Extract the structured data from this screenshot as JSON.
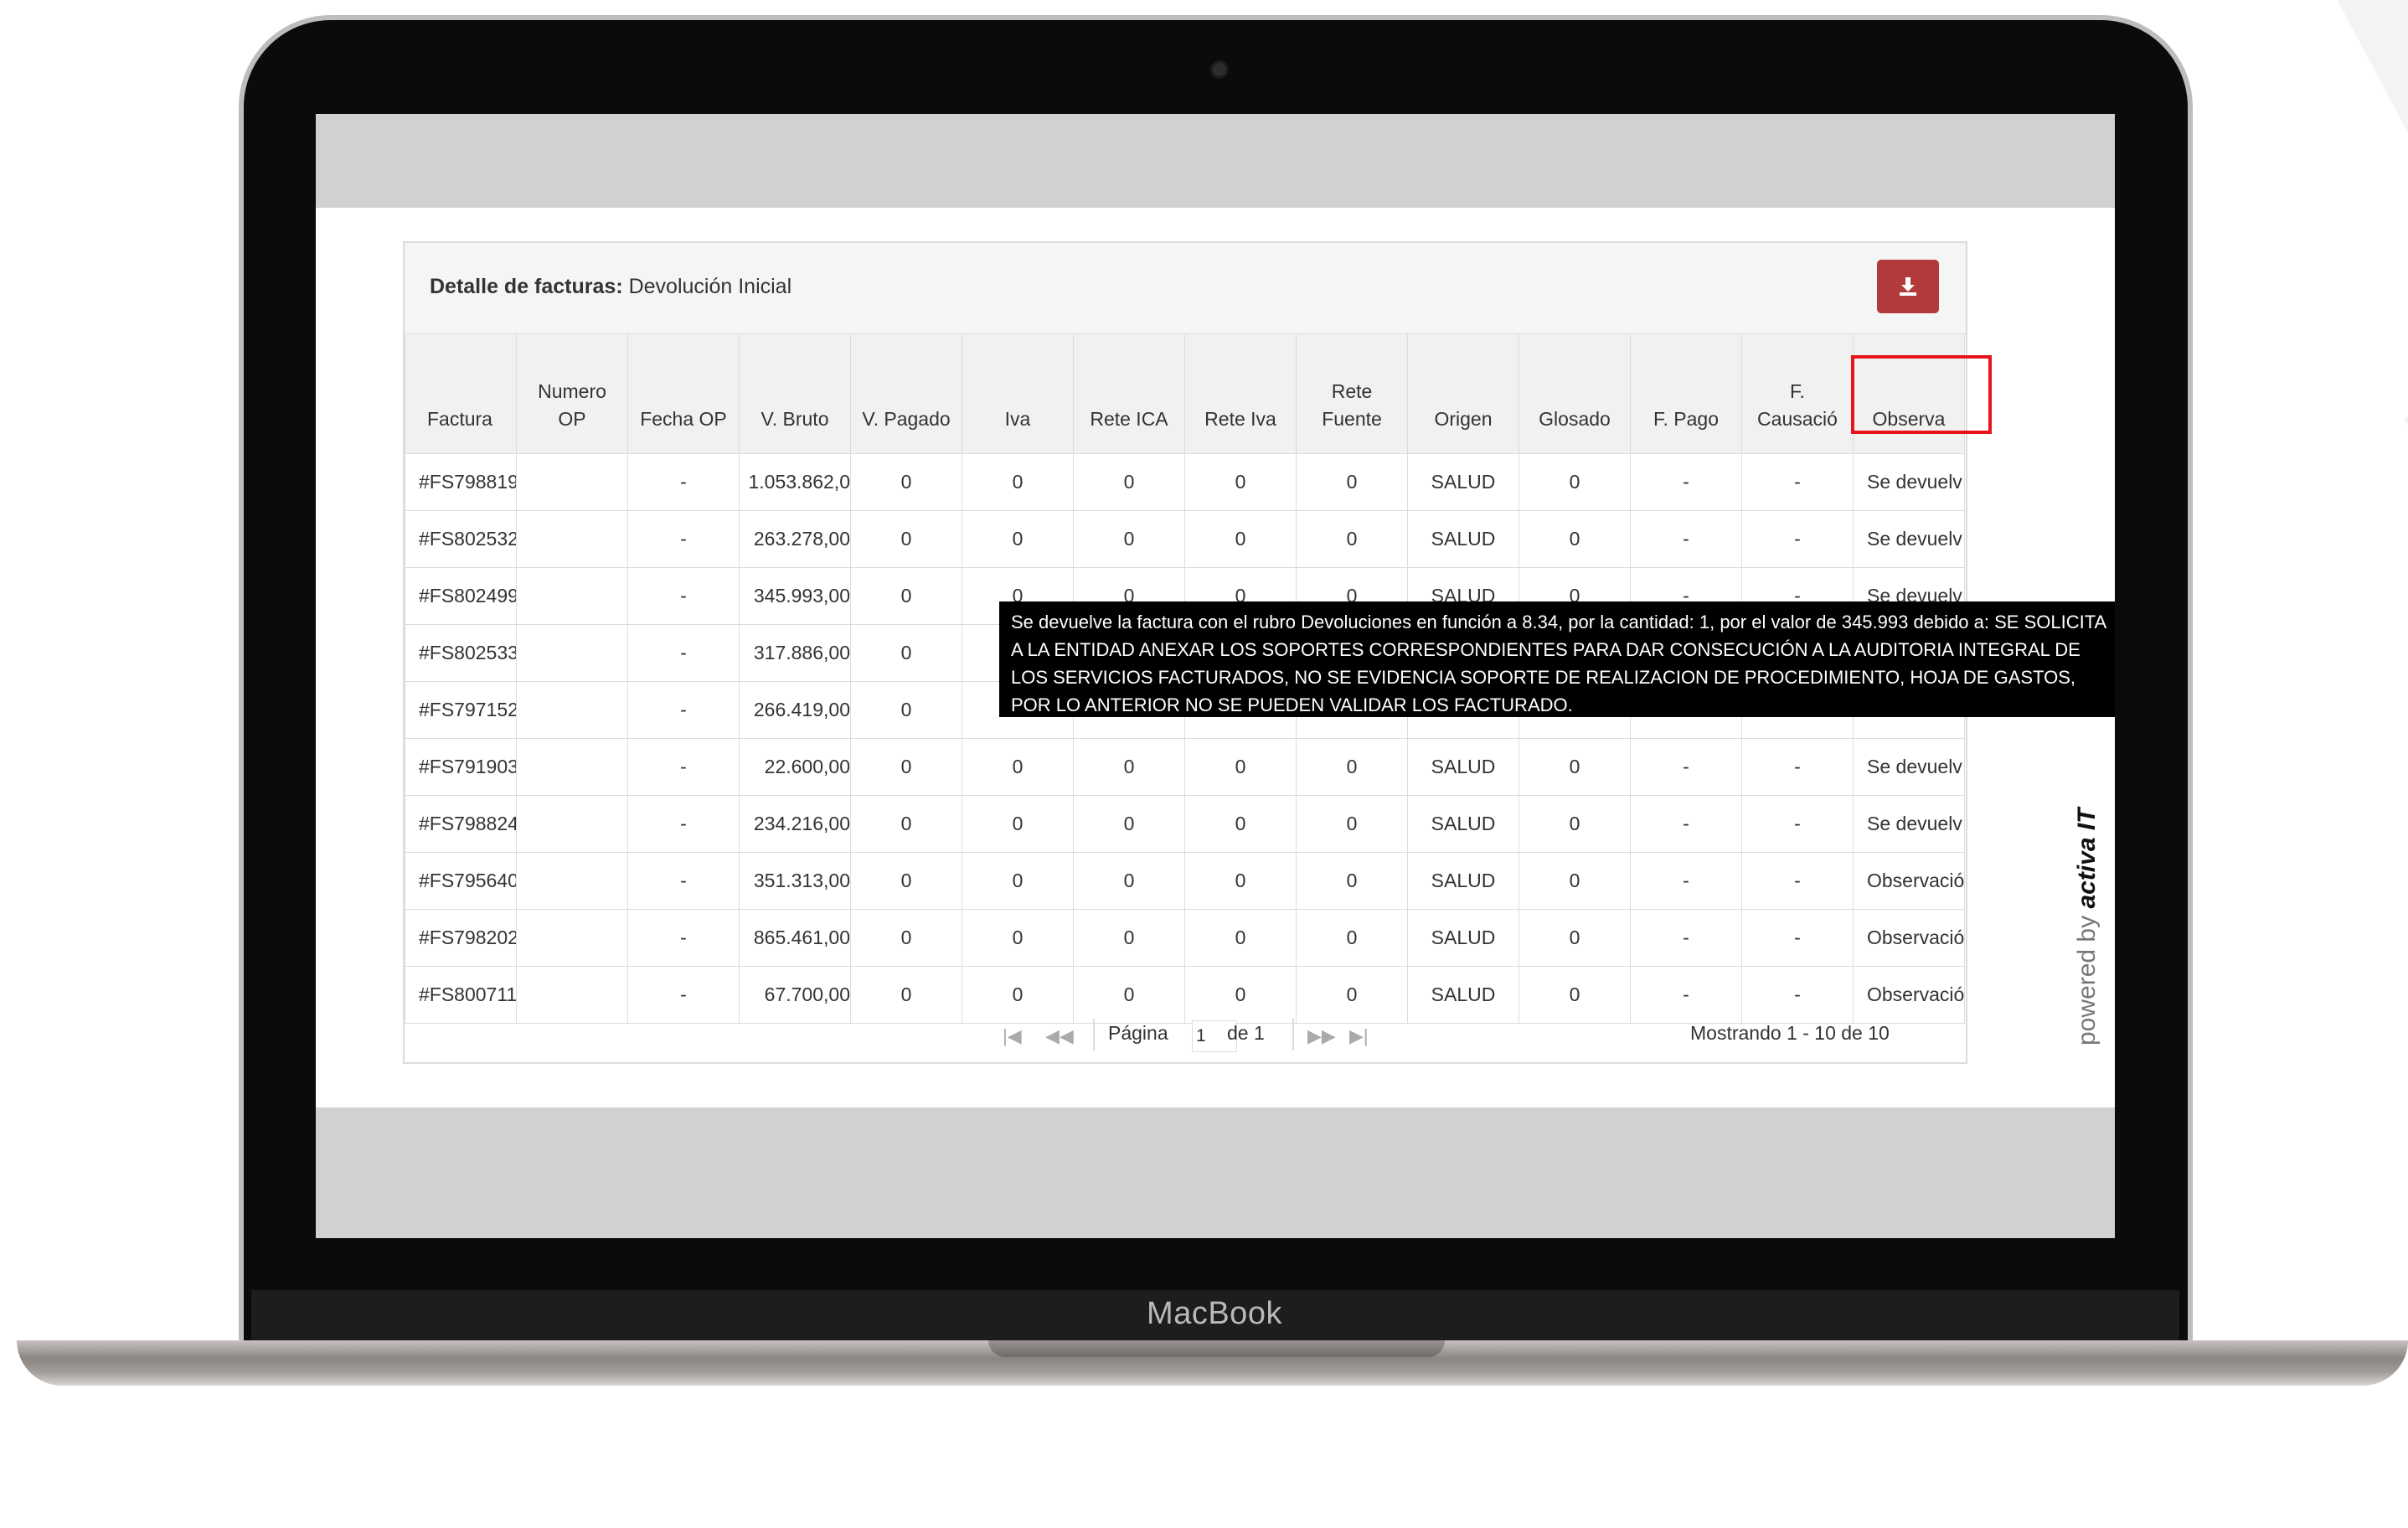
{
  "device": {
    "brand_label": "MacBook"
  },
  "panel": {
    "title_label": "Detalle de facturas:",
    "title_value": "Devolución Inicial",
    "download_icon": "download-icon"
  },
  "table": {
    "headers": [
      "Factura",
      "Numero OP",
      "Fecha OP",
      "V. Bruto",
      "V. Pagado",
      "Iva",
      "Rete ICA",
      "Rete Iva",
      "Rete Fuente",
      "Origen",
      "Glosado",
      "F. Pago",
      "F. Causació",
      "Observa"
    ],
    "rows": [
      [
        "#FS798819",
        "",
        "-",
        "1.053.862,0",
        "0",
        "0",
        "0",
        "0",
        "0",
        "SALUD",
        "0",
        "-",
        "-",
        "Se devuelv"
      ],
      [
        "#FS802532",
        "",
        "-",
        "263.278,00",
        "0",
        "0",
        "0",
        "0",
        "0",
        "SALUD",
        "0",
        "-",
        "-",
        "Se devuelv"
      ],
      [
        "#FS802499",
        "",
        "-",
        "345.993,00",
        "0",
        "0",
        "0",
        "0",
        "0",
        "SALUD",
        "0",
        "-",
        "-",
        "Se devuelv"
      ],
      [
        "#FS802533",
        "",
        "-",
        "317.886,00",
        "0",
        "",
        "",
        "",
        "",
        "",
        "",
        "",
        "",
        ""
      ],
      [
        "#FS797152",
        "",
        "-",
        "266.419,00",
        "0",
        "",
        "",
        "",
        "",
        "",
        "",
        "",
        "",
        ""
      ],
      [
        "#FS791903",
        "",
        "-",
        "22.600,00",
        "0",
        "0",
        "0",
        "0",
        "0",
        "SALUD",
        "0",
        "-",
        "-",
        "Se devuelv"
      ],
      [
        "#FS798824",
        "",
        "-",
        "234.216,00",
        "0",
        "0",
        "0",
        "0",
        "0",
        "SALUD",
        "0",
        "-",
        "-",
        "Se devuelv"
      ],
      [
        "#FS795640",
        "",
        "-",
        "351.313,00",
        "0",
        "0",
        "0",
        "0",
        "0",
        "SALUD",
        "0",
        "-",
        "-",
        "Observació"
      ],
      [
        "#FS798202",
        "",
        "-",
        "865.461,00",
        "0",
        "0",
        "0",
        "0",
        "0",
        "SALUD",
        "0",
        "-",
        "-",
        "Observació"
      ],
      [
        "#FS800711",
        "",
        "-",
        "67.700,00",
        "0",
        "0",
        "0",
        "0",
        "0",
        "SALUD",
        "0",
        "-",
        "-",
        "Observació"
      ]
    ]
  },
  "pager": {
    "page_label": "Página",
    "page_value": "1",
    "of_label": "de 1",
    "showing": "Mostrando 1 - 10 de 10"
  },
  "tooltip": {
    "text": "Se devuelve la factura con el rubro Devoluciones en función a 8.34, por la cantidad: 1, por el valor de 345.993 debido a: SE SOLICITA A LA ENTIDAD ANEXAR LOS SOPORTES CORRESPONDIENTES PARA DAR CONSECUCIÓN A LA AUDITORIA INTEGRAL DE LOS SERVICIOS FACTURADOS, NO SE EVIDENCIA SOPORTE DE REALIZACION DE PROCEDIMIENTO, HOJA DE GASTOS, POR LO ANTERIOR NO SE PUEDEN VALIDAR LOS FACTURADO."
  },
  "footer": {
    "powered_prefix": "powered by",
    "powered_brand": "activa IT"
  },
  "colors": {
    "accent": "#b23a3a",
    "highlight": "#e8141b",
    "tooltip_bg": "#000000"
  }
}
